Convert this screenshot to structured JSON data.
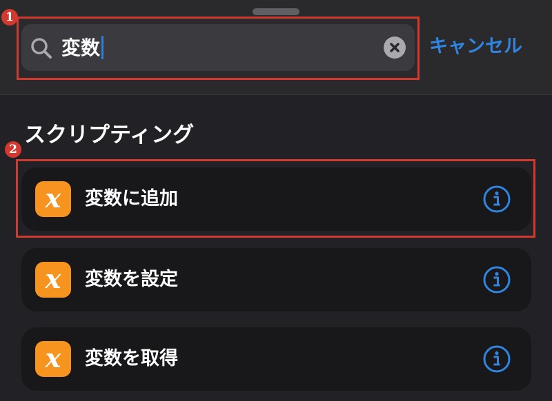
{
  "search": {
    "value": "変数",
    "cancel_label": "キャンセル"
  },
  "annotations": {
    "marker_1": "1",
    "marker_2": "2",
    "color": "#d2392f"
  },
  "section": {
    "title": "スクリプティング"
  },
  "actions": [
    {
      "label": "変数に追加",
      "icon": "x-variable-icon",
      "icon_glyph": "x",
      "icon_color": "#f79420"
    },
    {
      "label": "変数を設定",
      "icon": "x-variable-icon",
      "icon_glyph": "x",
      "icon_color": "#f79420"
    },
    {
      "label": "変数を取得",
      "icon": "x-variable-icon",
      "icon_glyph": "x",
      "icon_color": "#f79420"
    }
  ],
  "colors": {
    "accent": "#2f85e0",
    "background": "#222226",
    "row_background": "#18181a"
  }
}
